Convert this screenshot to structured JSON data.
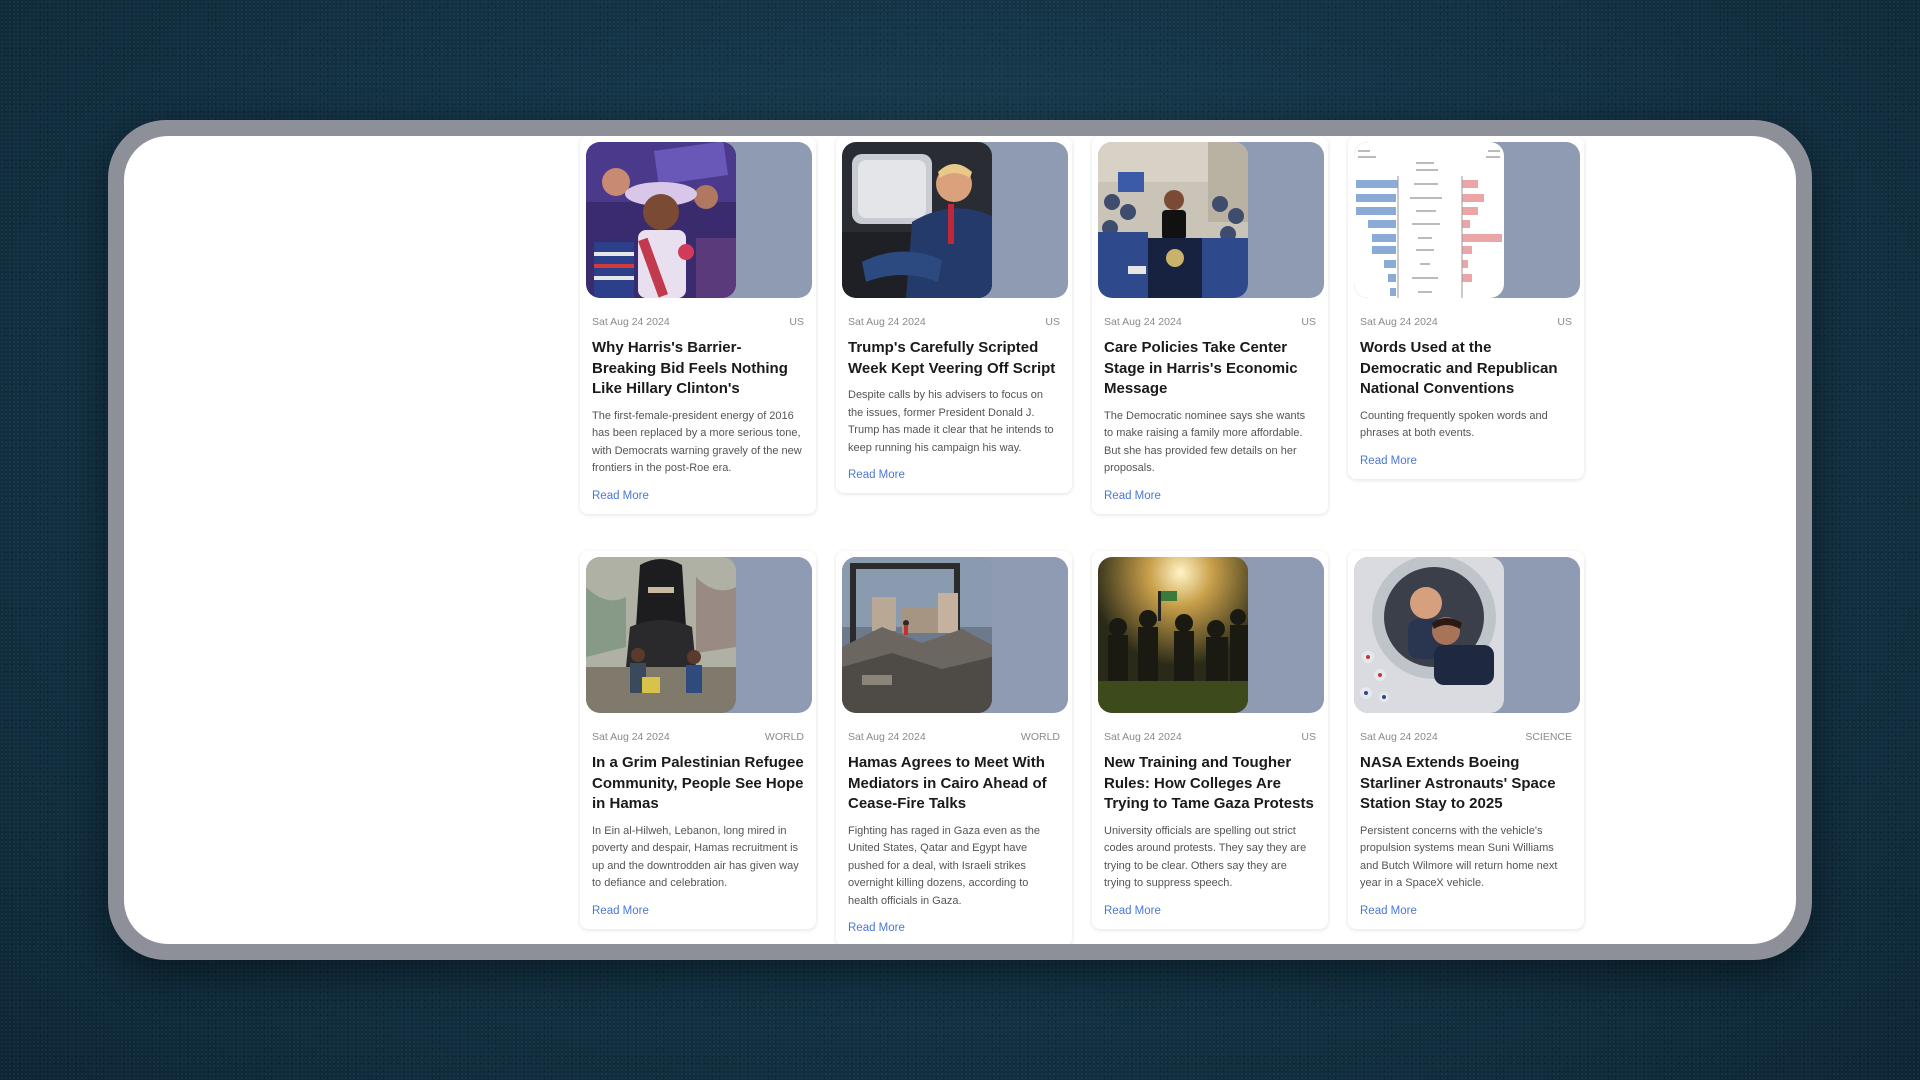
{
  "colors": {
    "accent": "#4a78d4",
    "thumb_bg": "#8e9bb3"
  },
  "cards": [
    {
      "date": "Sat Aug 24 2024",
      "section": "US",
      "title": "Why Harris's Barrier-Breaking Bid Feels Nothing Like Hillary Clinton's",
      "description": "The first-female-president energy of 2016 has been replaced by a more serious tone, with Democrats warning gravely of the new frontiers in the post-Roe era.",
      "link": "Read More",
      "image": "convention-delegate-photo"
    },
    {
      "date": "Sat Aug 24 2024",
      "section": "US",
      "title": "Trump's Carefully Scripted Week Kept Veering Off Script",
      "description": "Despite calls by his advisers to focus on the issues, former President Donald J. Trump has made it clear that he intends to keep running his campaign his way.",
      "link": "Read More",
      "image": "trump-in-car-photo"
    },
    {
      "date": "Sat Aug 24 2024",
      "section": "US",
      "title": "Care Policies Take Center Stage in Harris's Economic Message",
      "description": "The Democratic nominee says she wants to make raising a family more affordable. But she has provided few details on her proposals.",
      "link": "Read More",
      "image": "harris-podium-photo"
    },
    {
      "date": "Sat Aug 24 2024",
      "section": "US",
      "title": "Words Used at the Democratic and Republican National Conventions",
      "description": "Counting frequently spoken words and phrases at both events.",
      "link": "Read More",
      "image": "word-count-chart"
    },
    {
      "date": "Sat Aug 24 2024",
      "section": "WORLD",
      "title": "In a Grim Palestinian Refugee Community, People See Hope in Hamas",
      "description": "In Ein al-Hilweh, Lebanon, long mired in poverty and despair, Hamas recruitment is up and the downtrodden air has given way to defiance and celebration.",
      "link": "Read More",
      "image": "mural-children-photo"
    },
    {
      "date": "Sat Aug 24 2024",
      "section": "WORLD",
      "title": "Hamas Agrees to Meet With Mediators in Cairo Ahead of Cease-Fire Talks",
      "description": "Fighting has raged in Gaza even as the United States, Qatar and Egypt have pushed for a deal, with Israeli strikes overnight killing dozens, according to health officials in Gaza.",
      "link": "Read More",
      "image": "rubble-photo"
    },
    {
      "date": "Sat Aug 24 2024",
      "section": "US",
      "title": "New Training and Tougher Rules: How Colleges Are Trying to Tame Gaza Protests",
      "description": "University officials are spelling out strict codes around protests. They say they are trying to be clear. Others say they are trying to suppress speech.",
      "link": "Read More",
      "image": "campus-protest-photo"
    },
    {
      "date": "Sat Aug 24 2024",
      "section": "SCIENCE",
      "title": "NASA Extends Boeing Starliner Astronauts' Space Station Stay to 2025",
      "description": "Persistent concerns with the vehicle's propulsion systems mean Suni Williams and Butch Wilmore will return home next year in a SpaceX vehicle.",
      "link": "Read More",
      "image": "astronauts-hatch-photo"
    }
  ]
}
